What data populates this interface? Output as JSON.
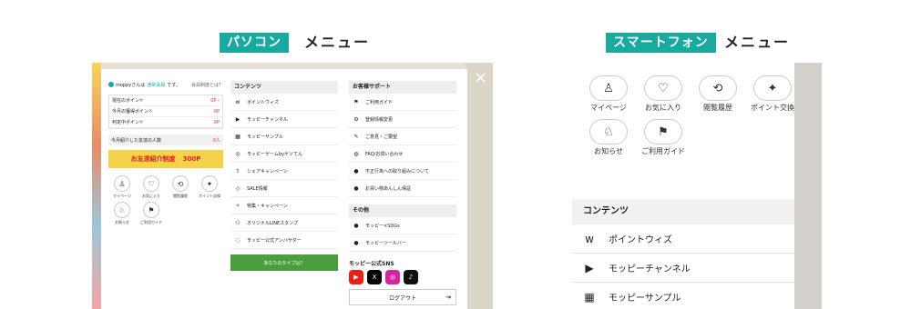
{
  "labels": {
    "pc_tag": "パソコン",
    "pc_title": "メニュー",
    "sp_tag": "スマートフォン",
    "sp_title": "メニュー"
  },
  "pc": {
    "close": "×",
    "user_name": "moppyさんは",
    "user_rank": "通常会員",
    "user_suffix": "です。",
    "user_link": "会員制度とは？",
    "points": [
      {
        "label": "現在のポイント",
        "value": "0P ›"
      },
      {
        "label": "今月の獲得ポイント",
        "value": "0P"
      },
      {
        "label": "判定中ポイント",
        "value": "0P"
      }
    ],
    "friends": {
      "label": "今月紹介した友達の人数",
      "value": "0人"
    },
    "banner_text": "お友達紹介制度",
    "banner_points": "300P",
    "grid": [
      {
        "icon": "♙",
        "label": "マイページ"
      },
      {
        "icon": "♡",
        "label": "お気に入り"
      },
      {
        "icon": "⟲",
        "label": "閲覧履歴"
      },
      {
        "icon": "✦",
        "label": "ポイント交換"
      },
      {
        "icon": "♘",
        "label": "お知らせ"
      },
      {
        "icon": "⚑",
        "label": "ご利用ガイド"
      }
    ],
    "contents_header": "コンテンツ",
    "contents": [
      {
        "icon": "w",
        "label": "ポイントウィズ"
      },
      {
        "icon": "▶",
        "label": "モッピーチャンネル"
      },
      {
        "icon": "▦",
        "label": "モッピーサンプル"
      },
      {
        "icon": "◎",
        "label": "モッピーゲームbyゲソてん"
      },
      {
        "icon": "⇪",
        "label": "シェアキャンペーン"
      },
      {
        "icon": "◇",
        "label": "SALE情報"
      },
      {
        "icon": "✧",
        "label": "特集・キャンペーン"
      },
      {
        "icon": "⚇",
        "label": "オリジナルLINEスタンプ"
      },
      {
        "icon": "◌",
        "label": "モッピー公式アンバサダー"
      }
    ],
    "green_banner": "あなたのタイプは？",
    "support_header": "お客様サポート",
    "support": [
      {
        "icon": "⚑",
        "label": "ご利用ガイド"
      },
      {
        "icon": "⚙",
        "label": "登録情報変更"
      },
      {
        "icon": "✎",
        "label": "ご意見・ご要望"
      },
      {
        "icon": "◍",
        "label": "FAQ/お問い合わせ"
      },
      {
        "icon": "●",
        "label": "不正行為への取り組みについて"
      },
      {
        "icon": "●",
        "label": "お買い物あんしん保証"
      }
    ],
    "other_header": "その他",
    "other": [
      {
        "icon": "●",
        "label": "モッピー×SDGs"
      },
      {
        "icon": "●",
        "label": "モッピーツールバー"
      }
    ],
    "sns_title": "モッピー公式SNS",
    "sns": [
      {
        "icon": "▶",
        "color": "#e62117"
      },
      {
        "icon": "X",
        "color": "#000000"
      },
      {
        "icon": "◎",
        "color": "#d6249f"
      },
      {
        "icon": "♪",
        "color": "#111111"
      }
    ],
    "logout": "ログアウト"
  },
  "sp": {
    "grid": [
      {
        "icon": "♙",
        "label": "マイページ"
      },
      {
        "icon": "♡",
        "label": "お気に入り"
      },
      {
        "icon": "⟲",
        "label": "閲覧履歴"
      },
      {
        "icon": "✦",
        "label": "ポイント交換"
      },
      {
        "icon": "♘",
        "label": "お知らせ"
      },
      {
        "icon": "⚑",
        "label": "ご利用ガイド"
      }
    ],
    "contents_header": "コンテンツ",
    "contents": [
      {
        "icon": "w",
        "label": "ポイントウィズ"
      },
      {
        "icon": "▶",
        "label": "モッピーチャンネル"
      },
      {
        "icon": "▦",
        "label": "モッピーサンプル"
      }
    ]
  },
  "colors": {
    "accent": "#1aa99f",
    "points": "#dd3333"
  }
}
